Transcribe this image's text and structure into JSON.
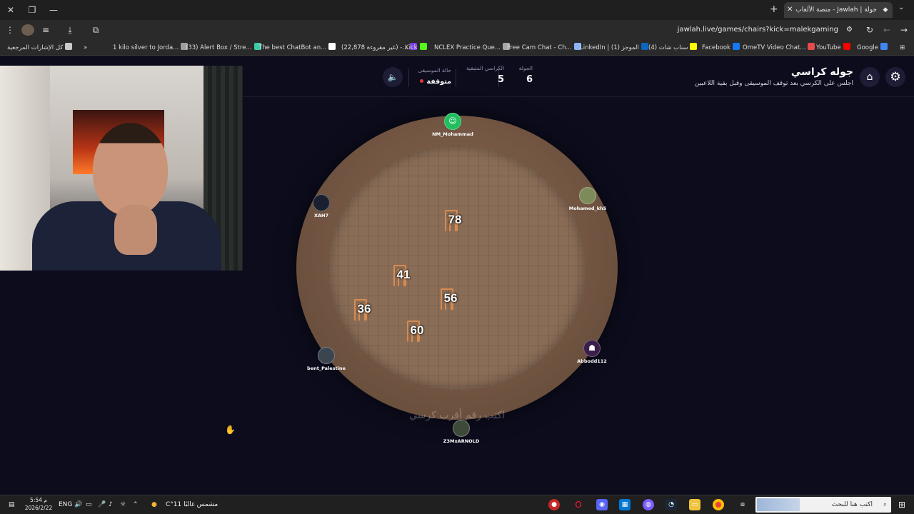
{
  "browser": {
    "tab_title": "جولة | Jawlah - منصة الألعاب",
    "url": "jawlah.live/games/chairs?kick=malekgaming",
    "bookmarks": [
      {
        "label": "كل الإشارات المرجعية",
        "icon": "folder-icon",
        "color": "#c9c9c9"
      },
      {
        "label": "1 kilo silver to Jorda...",
        "icon": "globe-icon",
        "color": "#9e9e9e"
      },
      {
        "label": "(33) Alert Box / Stre...",
        "icon": "chatbot-icon",
        "color": "#3cc9a6"
      },
      {
        "label": "The best ChatBot an...",
        "icon": "streamelements-icon",
        "color": "#ffffff"
      },
      {
        "label": "(22,878 غير مقروءة) -...",
        "icon": "mail-icon",
        "color": "#7b3fe4"
      },
      {
        "label": "Kick",
        "icon": "kick-icon",
        "color": "#53fc18"
      },
      {
        "label": "NCLEX Practice Que...",
        "icon": "ncsbn-icon",
        "color": "#a7a7a7"
      },
      {
        "label": "Free Cam Chat - Ch...",
        "icon": "camchat-icon",
        "color": "#8ab4f8"
      },
      {
        "label": "LinkedIn | الموجز (1)",
        "icon": "linkedin-icon",
        "color": "#0a66c2"
      },
      {
        "label": "(4) سناب شات",
        "icon": "snapchat-icon",
        "color": "#fffc00"
      },
      {
        "label": "Facebook",
        "icon": "facebook-icon",
        "color": "#1877f2"
      },
      {
        "label": "OmeTV Video Chat...",
        "icon": "ometv-icon",
        "color": "#e64a4a"
      },
      {
        "label": "YouTube",
        "icon": "youtube-icon",
        "color": "#ff0000"
      },
      {
        "label": "Google",
        "icon": "google-icon",
        "color": "#4285f4"
      }
    ]
  },
  "game": {
    "title": "جوله كراسي",
    "subtitle": "اجلس على الكرسي بعد توقف الموسيقى وقبل بقية اللاعبين",
    "stats": {
      "round_label": "الجولة",
      "round_value": "6",
      "chairs_label": "الكراسي المتبقية",
      "chairs_value": "5",
      "music_label": "حالة الموسيقى",
      "music_value": "متوقفة"
    },
    "hint": "اكتب رقم أقرب كرسي",
    "chairs": [
      {
        "number": "78"
      },
      {
        "number": "41"
      },
      {
        "number": "56"
      },
      {
        "number": "36"
      },
      {
        "number": "60"
      }
    ],
    "players": [
      {
        "name": "NM_Mohammad",
        "avatar_color": "#1fbf5f",
        "icon": "robot-icon"
      },
      {
        "name": "XAH7",
        "avatar_color": "#1a2030",
        "icon": "avatar-icon"
      },
      {
        "name": "Mohamed_kh5",
        "avatar_color": "#7d8a5a",
        "icon": "avatar-icon"
      },
      {
        "name": "bent_Palestine",
        "avatar_color": "#3b4550",
        "icon": "avatar-icon"
      },
      {
        "name": "Abbodd112",
        "avatar_color": "#3a1f4a",
        "icon": "ghost-icon"
      },
      {
        "name": "Z3MxARNOLD",
        "avatar_color": "#3d4a3a",
        "icon": "avatar-icon"
      }
    ]
  },
  "taskbar": {
    "search_placeholder": "اكتب هنا للبحث",
    "weather": "مشمس غالبًا  11°C",
    "lang": "ENG",
    "time": "5:54 م",
    "date": "2026/2/22"
  }
}
